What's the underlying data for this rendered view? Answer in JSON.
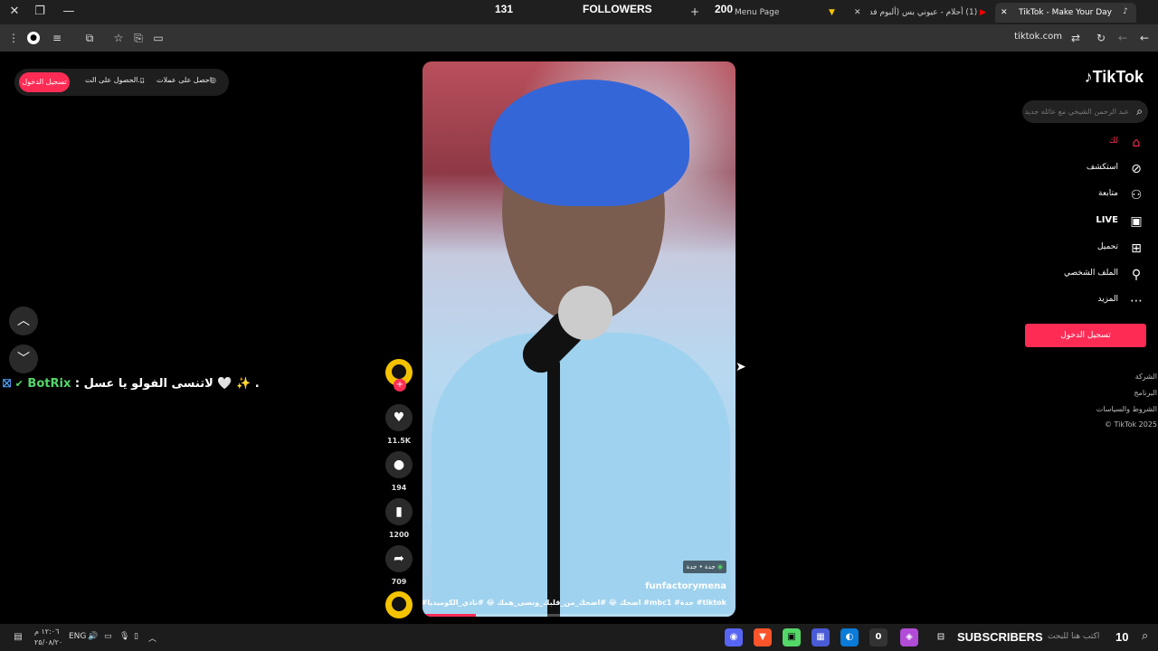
{
  "overlay": {
    "followers_count": "131",
    "followers_label": "FOLLOWERS",
    "followers_goal": "200",
    "subscribers_label": "SUBSCRIBERS",
    "subscribers_count": "10"
  },
  "tabs": [
    {
      "label": "Menu Page"
    },
    {
      "label": "(1) أحلام - عيوني بس (ألبوم فدوة"
    },
    {
      "label": "TikTok - Make Your Day"
    }
  ],
  "toolbar": {
    "url": "tiktok.com"
  },
  "topbar": {
    "login_label": "تسجيل الدخول",
    "get_app_label": "الحصول على الت...",
    "get_coins_label": "احصل على عملات"
  },
  "chat": {
    "username": "BotRix",
    "message": ": لاتنسى الفولو يا عسل 🤍 ✨ ."
  },
  "video": {
    "location_tag": "جدة • جدة",
    "author": "funfactorymena",
    "caption": "#اضحك 😂 #اضحك_من_قلبك_ونسى_همك 😂 #نادي_الكوميديا #mbc1 #جدة #tiktok",
    "progress": 0.17
  },
  "actions": {
    "likes": "11.5K",
    "comments": "194",
    "saves": "1200",
    "shares": "709"
  },
  "sidebar": {
    "logo": "TikTok",
    "search_placeholder": "عبد الرحمن الشيخي مع عائله جديده",
    "nav": [
      {
        "label": "لك",
        "icon": "home-icon"
      },
      {
        "label": "استكشف",
        "icon": "compass-icon"
      },
      {
        "label": "متابعة",
        "icon": "following-icon"
      },
      {
        "label": "LIVE",
        "icon": "live-icon"
      },
      {
        "label": "تحميل",
        "icon": "upload-icon"
      },
      {
        "label": "الملف الشخصي",
        "icon": "profile-icon"
      },
      {
        "label": "المزيد",
        "icon": "more-icon"
      }
    ],
    "login_button": "تسجيل الدخول",
    "footer": [
      "الشركة",
      "البرنامج",
      "الشروط والسياسات",
      "© TikTok 2025"
    ]
  },
  "taskbar": {
    "search_placeholder": "اكتب هنا للبحث",
    "lang": "ENG",
    "time": "١٢:٠٦ م",
    "date": "٢٥/٠٨/٢٠",
    "badge": "0"
  },
  "colors": {
    "accent": "#fe2c55",
    "background": "#000000",
    "botrix_green": "#53d769"
  }
}
